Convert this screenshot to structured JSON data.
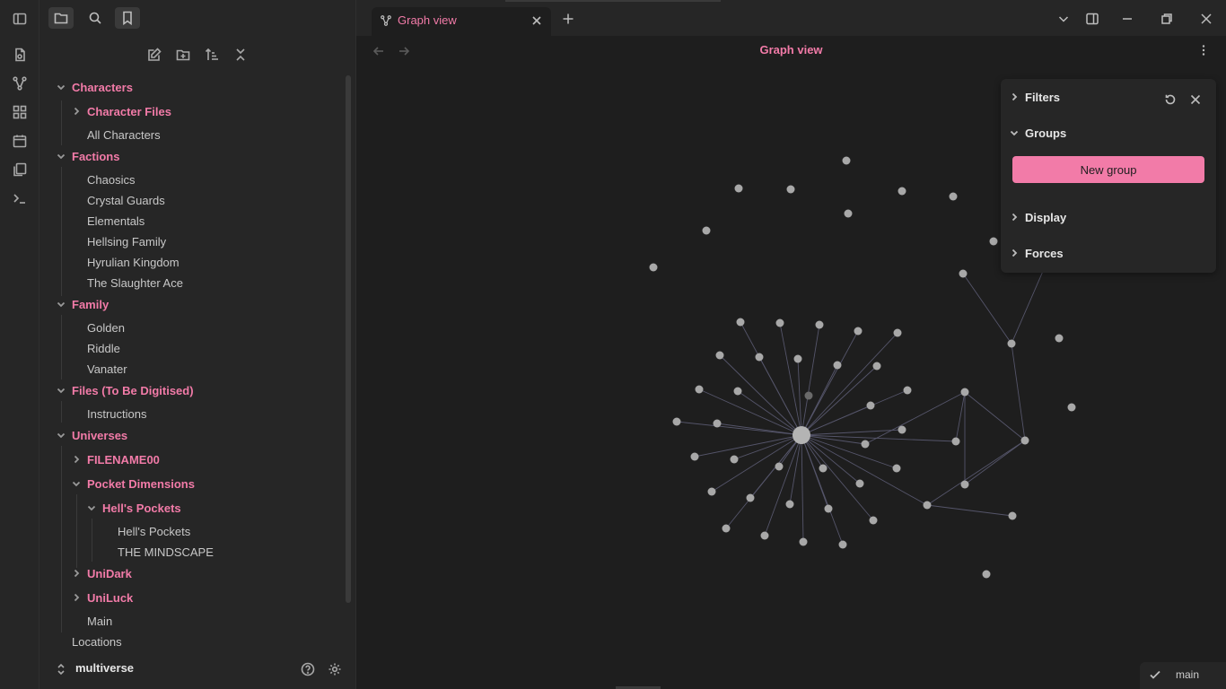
{
  "tab": {
    "title": "Graph view"
  },
  "view": {
    "title": "Graph view"
  },
  "tree": {
    "characters": "Characters",
    "character_files": "Character Files",
    "all_characters": "All Characters",
    "factions": "Factions",
    "chaosics": "Chaosics",
    "crystal_guards": "Crystal Guards",
    "elementals": "Elementals",
    "hellsing_family": "Hellsing Family",
    "hyrulian_kingdom": "Hyrulian Kingdom",
    "slaughter_ace": "The Slaughter Ace",
    "family": "Family",
    "golden": "Golden",
    "riddle": "Riddle",
    "vanater": "Vanater",
    "files_tbd": "Files (To Be Digitised)",
    "instructions": "Instructions",
    "universes": "Universes",
    "filename00": "FILENAME00",
    "pocket_dimensions": "Pocket Dimensions",
    "hells_pockets_folder": "Hell's Pockets",
    "hells_pockets_file": "Hell's Pockets",
    "mindscape": "THE MINDSCAPE",
    "unidark": "UniDark",
    "uniluck": "UniLuck",
    "main": "Main",
    "locations": "Locations"
  },
  "vault": {
    "name": "multiverse"
  },
  "graph_controls": {
    "filters": "Filters",
    "groups": "Groups",
    "new_group": "New group",
    "display": "Display",
    "forces": "Forces"
  },
  "status": {
    "branch": "main"
  },
  "colors": {
    "accent": "#f27ba8",
    "background": "#1e1e1e",
    "sidebar": "#262626",
    "node": "#a8a8a8",
    "edge": "#55556a"
  }
}
